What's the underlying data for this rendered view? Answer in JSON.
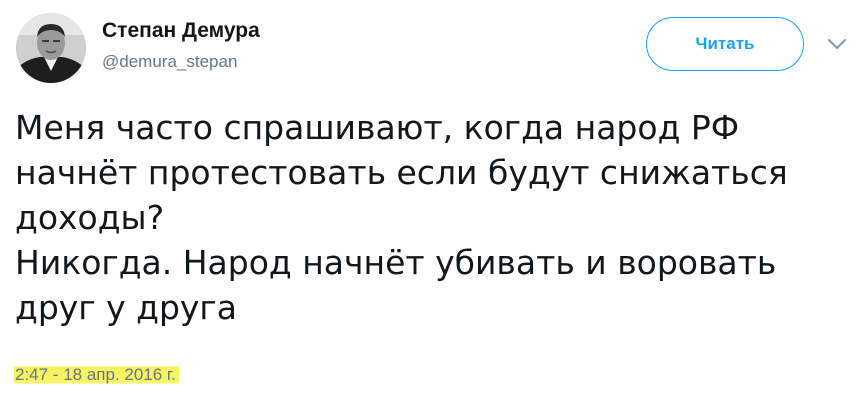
{
  "author": {
    "name": "Степан Демура",
    "handle": "@demura_stepan"
  },
  "follow_button": {
    "label": "Читать"
  },
  "icons": {
    "avatar": "avatar-photo",
    "caret": "chevron-down-icon"
  },
  "tweet": {
    "lines": [
      "Меня часто спрашивают, когда народ РФ",
      "начнёт протестовать если будут снижаться",
      "доходы?",
      "Никогда. Народ начнёт убивать и воровать",
      "друг у друга"
    ],
    "timestamp": "2:47 - 18 апр. 2016 г."
  },
  "colors": {
    "accent": "#1da1f2",
    "secondary_text": "#657786",
    "highlight": "#f4f25a"
  }
}
